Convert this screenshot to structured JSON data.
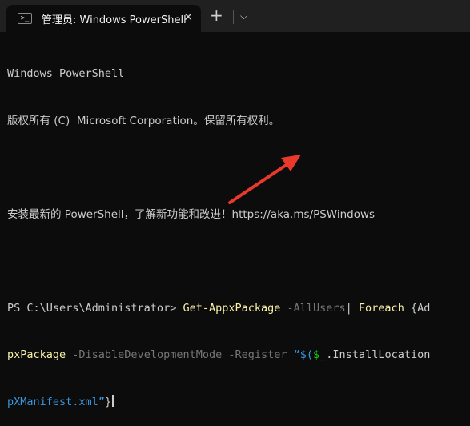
{
  "window": {
    "tab_title": "管理员: Windows PowerShell",
    "tab_icon_glyph": ">_",
    "close_glyph": "✕",
    "new_tab_glyph": "+",
    "dropdown_glyph": "⌵"
  },
  "terminal": {
    "line1": "Windows PowerShell",
    "line2": "版权所有 (C)  Microsoft Corporation。保留所有权利。",
    "line4": "安装最新的 PowerShell，了解新功能和改进！https://aka.ms/PSWindows",
    "prompt": "PS C:\\Users\\Administrator> ",
    "cmd1": "Get-AppxPackage",
    "param1": " -AllUsers",
    "pipe": "| ",
    "cmd2": "Foreach",
    "brace_open": " {Ad",
    "cmd3_wrap": "pxPackage",
    "param2": " -DisableDevelopmentMode",
    "param3": " -Register",
    "str_open": " “$(",
    "var": "$_",
    "prop": ".InstallLocation",
    "str_wrap": "pXManifest.xml”",
    "brace_close": "}"
  },
  "annotation": {
    "arrow_color": "#e8392c"
  }
}
